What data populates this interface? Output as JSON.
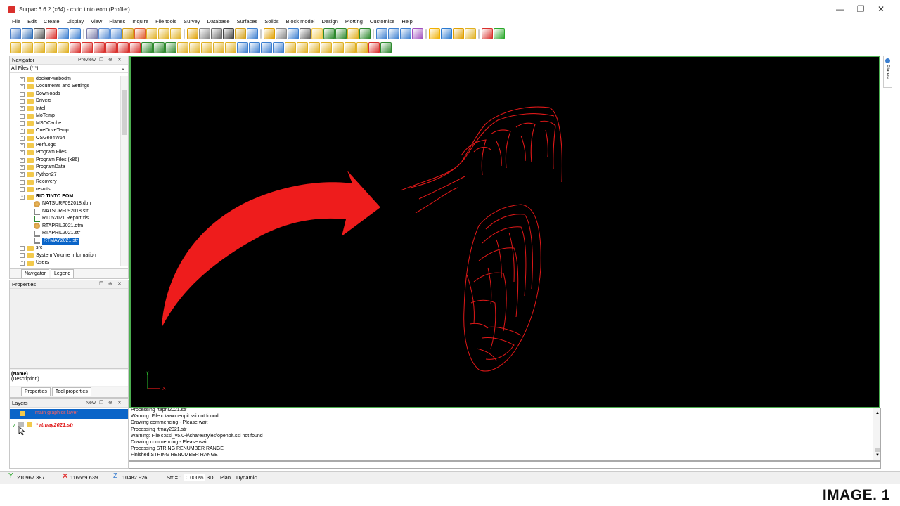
{
  "window": {
    "title": "Surpac 6.6.2 (x64) - c:\\rio tinto eom (Profile:)",
    "minimize_glyph": "—",
    "restore_glyph": "❐",
    "close_glyph": "✕"
  },
  "menu": [
    "File",
    "Edit",
    "Create",
    "Display",
    "View",
    "Planes",
    "Inquire",
    "File tools",
    "Survey",
    "Database",
    "Surfaces",
    "Solids",
    "Block model",
    "Design",
    "Plotting",
    "Customise",
    "Help"
  ],
  "navigator": {
    "title": "Navigator",
    "preview_label": "Preview",
    "filter": "All Files (*.*)",
    "tree": [
      {
        "label": "docker-webodm",
        "type": "folder",
        "depth": 1,
        "pm": "+"
      },
      {
        "label": "Documents and Settings",
        "type": "folder",
        "depth": 1,
        "pm": "+"
      },
      {
        "label": "Downloads",
        "type": "folder",
        "depth": 1,
        "pm": "+"
      },
      {
        "label": "Drivers",
        "type": "folder",
        "depth": 1,
        "pm": "+"
      },
      {
        "label": "Intel",
        "type": "folder",
        "depth": 1,
        "pm": "+"
      },
      {
        "label": "MoTemp",
        "type": "folder",
        "depth": 1,
        "pm": "+"
      },
      {
        "label": "MSOCache",
        "type": "folder",
        "depth": 1,
        "pm": "+"
      },
      {
        "label": "OneDriveTemp",
        "type": "folder",
        "depth": 1,
        "pm": "+"
      },
      {
        "label": "OSGeo4W64",
        "type": "folder",
        "depth": 1,
        "pm": "+"
      },
      {
        "label": "PerfLogs",
        "type": "folder",
        "depth": 1,
        "pm": "+"
      },
      {
        "label": "Program Files",
        "type": "folder",
        "depth": 1,
        "pm": "+"
      },
      {
        "label": "Program Files (x86)",
        "type": "folder",
        "depth": 1,
        "pm": "+"
      },
      {
        "label": "ProgramData",
        "type": "folder",
        "depth": 1,
        "pm": "+"
      },
      {
        "label": "Python27",
        "type": "folder",
        "depth": 1,
        "pm": "+"
      },
      {
        "label": "Recovery",
        "type": "folder",
        "depth": 1,
        "pm": "+"
      },
      {
        "label": "results",
        "type": "folder",
        "depth": 1,
        "pm": "+"
      },
      {
        "label": "RIO TINTO EOM",
        "type": "folder-open",
        "depth": 1,
        "pm": "−",
        "bold": true
      },
      {
        "label": "NATSURF092018.dtm",
        "type": "dtm",
        "depth": 2
      },
      {
        "label": "NATSURF092018.str",
        "type": "str",
        "depth": 2
      },
      {
        "label": "RT052021 Report.xls",
        "type": "xls",
        "depth": 2
      },
      {
        "label": "RTAPRIL2021.dtm",
        "type": "dtm",
        "depth": 2
      },
      {
        "label": "RTAPRIL2021.str",
        "type": "str",
        "depth": 2
      },
      {
        "label": "RTMAY2021.str",
        "type": "str",
        "depth": 2,
        "selected": true
      },
      {
        "label": "src",
        "type": "folder",
        "depth": 1,
        "pm": "+"
      },
      {
        "label": "System Volume Information",
        "type": "folder",
        "depth": 1,
        "pm": "+"
      },
      {
        "label": "Users",
        "type": "folder",
        "depth": 1,
        "pm": "+"
      }
    ],
    "tabs": [
      "Navigator",
      "Legend"
    ]
  },
  "properties": {
    "title": "Properties",
    "name_label": "(Name)",
    "desc_label": "(Description)",
    "tabs": [
      "Properties",
      "Tool properties"
    ]
  },
  "layers": {
    "title": "Layers",
    "new_label": "New",
    "items": [
      "main graphics layer",
      "* rtmay2021.str"
    ]
  },
  "console": {
    "lines": [
      "Processing rtapril2021.str",
      "Warning: File c:\\aa\\openpit.ssi not found",
      "Drawing commencing - Please wait",
      "Processing rtmay2021.str",
      "Warning: File c:\\ssi_v5.0-k\\share\\styles\\openpit.ssi not found",
      "Drawing commencing - Please wait",
      "Processing STRING RENUMBER RANGE",
      "Finished STRING RENUMBER RANGE"
    ]
  },
  "status": {
    "y": "210967.387",
    "x": "116669.639",
    "z": "10482.926",
    "str_label": "Str = 1",
    "percent": "0.000%",
    "mode3d": "3D",
    "view": "Plan",
    "dyn": "Dynamic"
  },
  "right_panel": {
    "label": "Planes"
  },
  "axis": {
    "y": "Y",
    "x": "X"
  },
  "colors": {
    "viewport_bg": "#000000",
    "viewport_border": "#4caf50",
    "string_red": "#e01818",
    "arrow_red": "#ee1c1c",
    "selection": "#0a64c8"
  },
  "caption": "IMAGE. 1"
}
